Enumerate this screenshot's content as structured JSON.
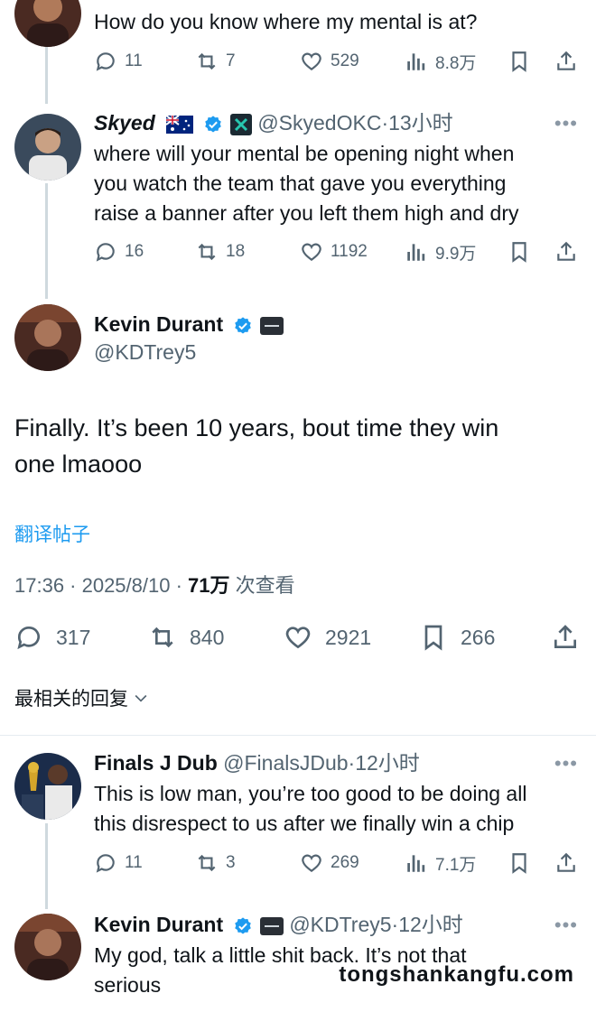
{
  "colors": {
    "accent": "#1d9bf0",
    "muted": "#536471",
    "verified": "#1d9bf0",
    "line": "#cfd9de"
  },
  "prev_reply": {
    "text": "How do you know where my mental is at?",
    "replies": "11",
    "retweets": "7",
    "likes": "529",
    "views": "8.8万"
  },
  "skyed": {
    "name": "Skyed",
    "handle_time": "@SkyedOKC·13小时",
    "text_lines": [
      "where will your mental be opening night when",
      "you watch the team that gave you everything",
      "raise a banner after you left them high and dry"
    ],
    "replies": "16",
    "retweets": "18",
    "likes": "1192",
    "views": "9.9万"
  },
  "main": {
    "name": "Kevin Durant",
    "handle": "@KDTrey5",
    "text_lines": [
      "Finally. It’s been 10 years, bout time they win",
      "one lmaooo"
    ],
    "translate": "翻译帖子",
    "time": "17:36 · 2025/8/10 · ",
    "views": "71万",
    "views_suffix": " 次查看",
    "replies": "317",
    "retweets": "840",
    "likes": "2921",
    "bookmarks": "266"
  },
  "sort": {
    "label": "最相关的回复"
  },
  "finals": {
    "name": "Finals J Dub",
    "handle_time": "@FinalsJDub·12小时",
    "text_lines": [
      "This is low man, you’re too good to be doing all",
      "this disrespect to us after we finally win a chip"
    ],
    "replies": "11",
    "retweets": "3",
    "likes": "269",
    "views": "7.1万"
  },
  "kd_reply": {
    "name": "Kevin Durant",
    "handle_time": "@KDTrey5·12小时",
    "text_lines": [
      "My god, talk a little shit back. It’s not that",
      "serious"
    ]
  },
  "more_label": "•••",
  "watermark": "tongshankangfu.com"
}
